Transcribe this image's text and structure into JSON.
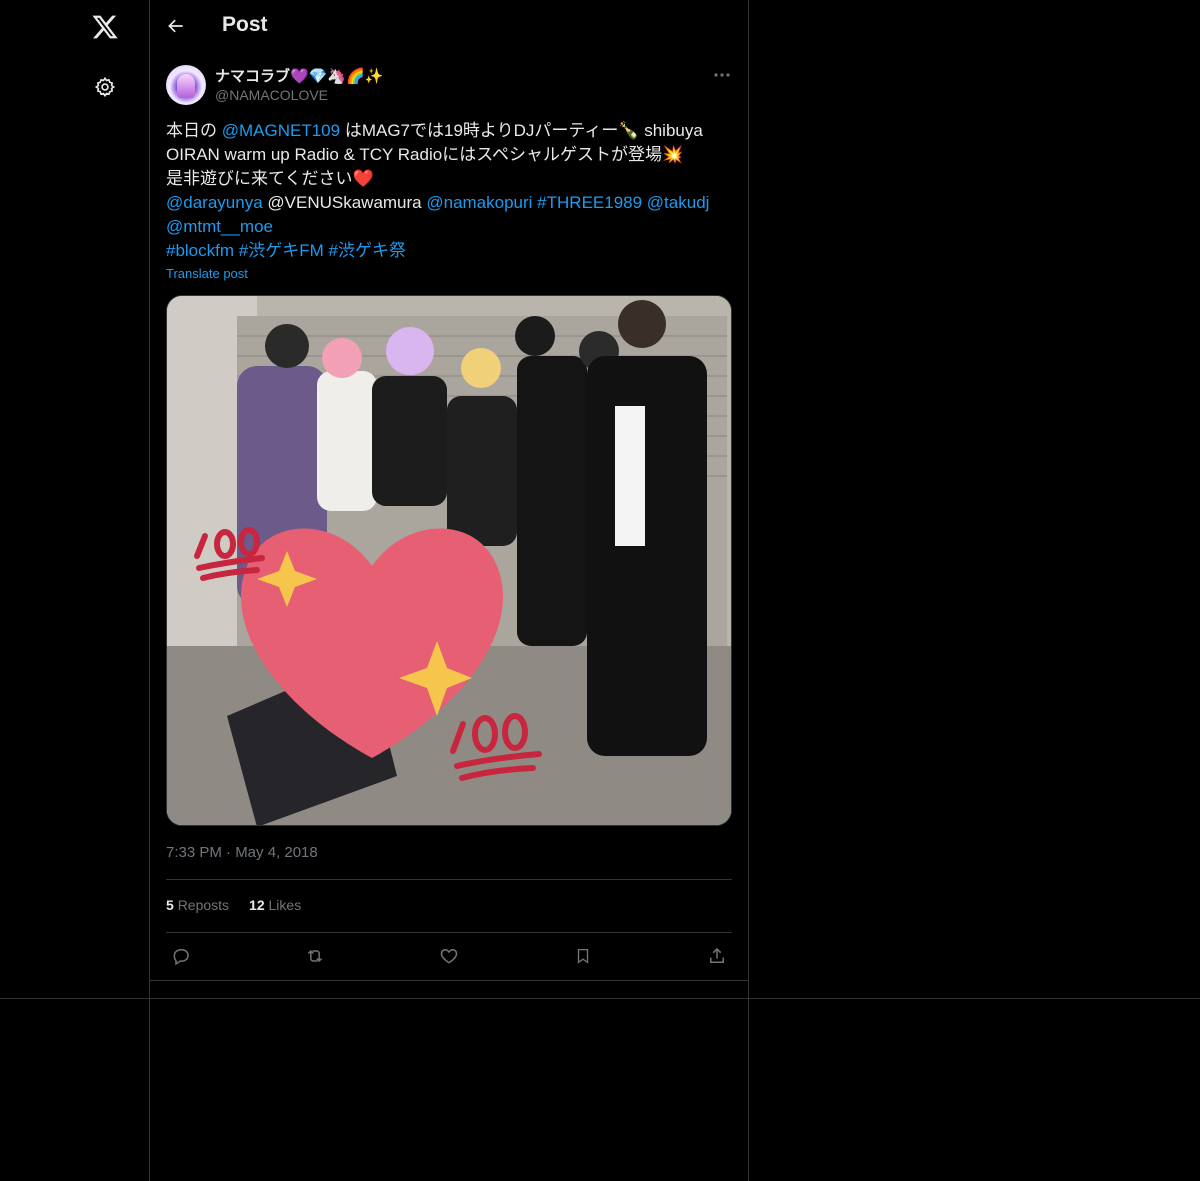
{
  "nav": {
    "logo": "x-logo-icon",
    "settings": "gear-icon"
  },
  "header": {
    "title": "Post",
    "back_icon": "arrow-left-icon"
  },
  "post": {
    "author": {
      "display_name": "ナマコラブ💜💎🦄🌈✨",
      "handle": "@NAMACOLOVE"
    },
    "text": {
      "l1_a": "本日の ",
      "l1_mention": "@MAGNET109",
      "l1_b": " はMAG7では19時よりDJパーティー🍾 shibuya",
      "l2": "OIRAN warm up Radio & TCY Radioにはスペシャルゲストが登場💥",
      "l3": "是非遊びに来てください❤️",
      "l4_m1": "@darayunya",
      "l4_plain": " @VENUSkawamura ",
      "l4_m2": "@namakopuri",
      "l4_h1": " #THREE1989",
      "l4_m3": " @takudj",
      "l5_m1": "@mtmt__moe",
      "l6_h1": "#blockfm",
      "l6_h2": " #渋ゲキFM",
      "l6_h3": " #渋ゲキ祭"
    },
    "translate_label": "Translate post",
    "timestamp": "7:33 PM · May 4, 2018",
    "reposts_count": "5",
    "reposts_label": "Reposts",
    "likes_count": "12",
    "likes_label": "Likes",
    "actions": {
      "reply": "reply-icon",
      "repost": "repost-icon",
      "like": "heart-icon",
      "bookmark": "bookmark-icon",
      "share": "share-icon"
    }
  },
  "colors": {
    "background": "#000000",
    "text": "#e7e9ea",
    "muted": "#71767b",
    "link": "#1d9bf0",
    "border": "#2f3336"
  }
}
